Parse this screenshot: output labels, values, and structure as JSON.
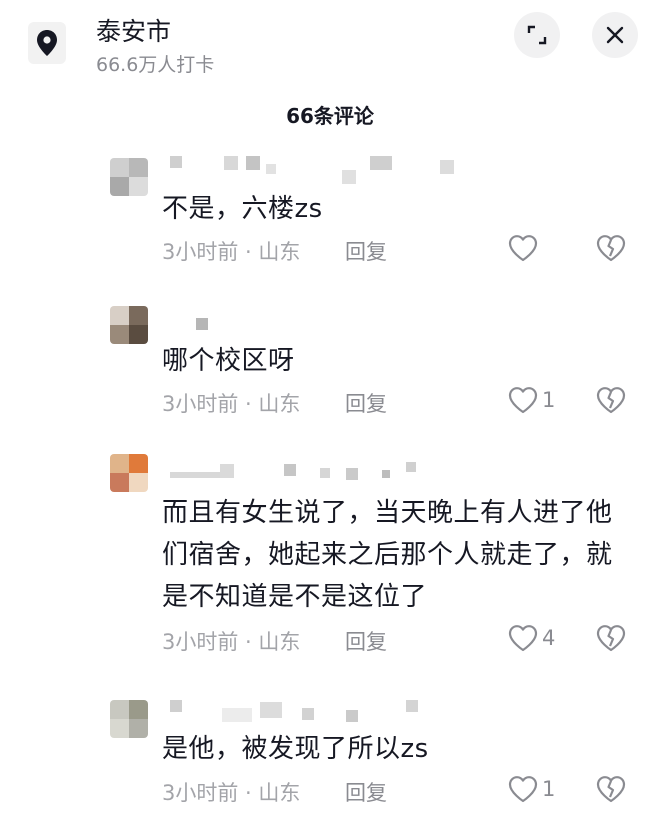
{
  "header": {
    "location_icon": "location-pin-icon",
    "title": "泰安市",
    "subtitle": "66.6万人打卡",
    "expand_icon": "expand-icon",
    "close_icon": "close-icon"
  },
  "comments_title": "66条评论",
  "comments": [
    {
      "text": "不是，六楼zs",
      "meta": "3小时前 · 山东",
      "reply": "回复",
      "likes": ""
    },
    {
      "text": "哪个校区呀",
      "meta": "3小时前 · 山东",
      "reply": "回复",
      "likes": "1"
    },
    {
      "text": "而且有女生说了，当天晚上有人进了他们宿舍，她起来之后那个人就走了，就是不知道是不是这位了",
      "meta": "3小时前 · 山东",
      "reply": "回复",
      "likes": "4"
    },
    {
      "text": "是他，被发现了所以zs",
      "meta": "3小时前 · 山东",
      "reply": "回复",
      "likes": "1"
    }
  ],
  "icons": {
    "like": "heart-outline-icon",
    "dislike": "broken-heart-icon"
  },
  "colors": {
    "primary_text": "#161823",
    "secondary_text": "#8a8b91",
    "meta_text": "#a3a4a9"
  }
}
